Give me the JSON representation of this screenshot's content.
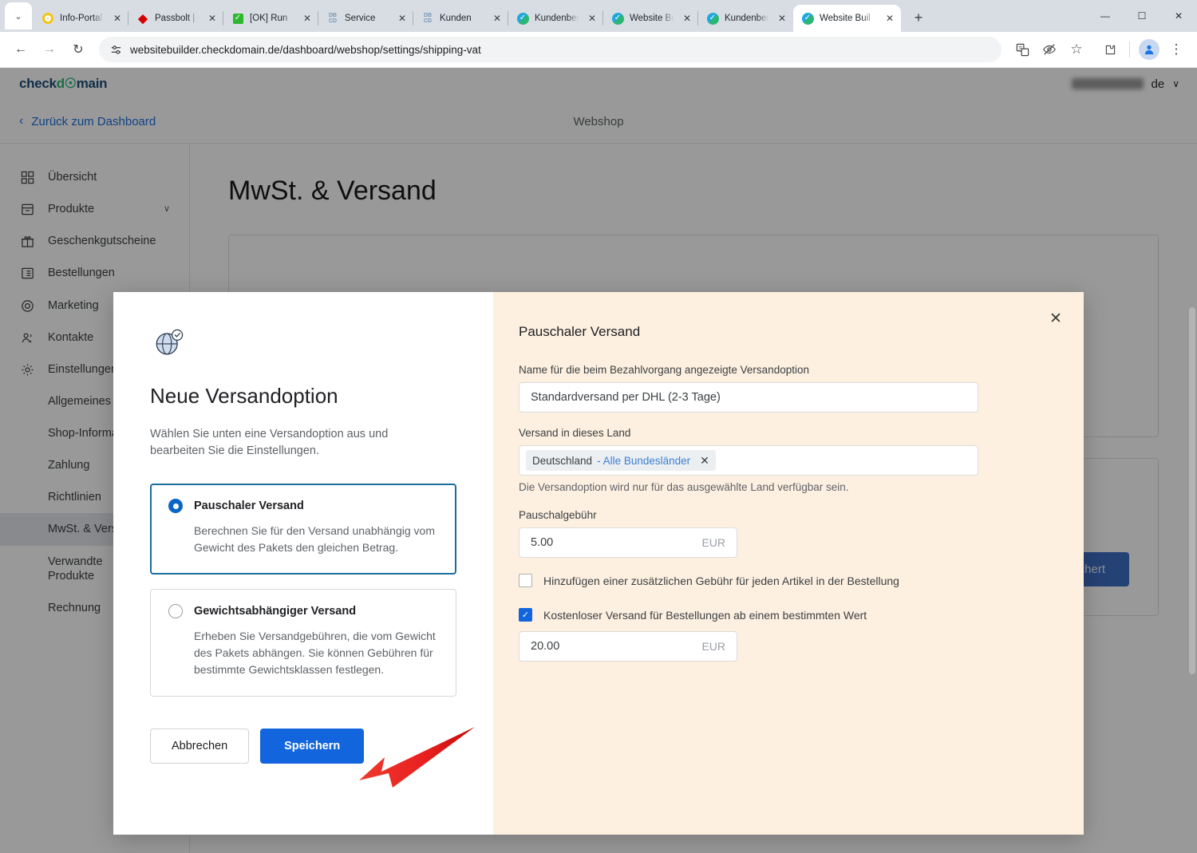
{
  "browser": {
    "tabs": [
      {
        "title": "Info-Portal D",
        "favicon": "circle-icon",
        "active": false
      },
      {
        "title": "Passbolt | Op",
        "favicon": "passbolt-icon",
        "active": false
      },
      {
        "title": "[OK] Run",
        "favicon": "green-check-icon",
        "active": false
      },
      {
        "title": "Service",
        "favicon": "dbcd-icon",
        "active": false
      },
      {
        "title": "Kunden",
        "favicon": "dbcd-icon",
        "active": false
      },
      {
        "title": "Kundenbere",
        "favicon": "checkdomain-icon",
        "active": false
      },
      {
        "title": "Website Buil",
        "favicon": "checkdomain-icon",
        "active": false
      },
      {
        "title": "Kundenbere",
        "favicon": "checkdomain-icon",
        "active": false
      },
      {
        "title": "Website Buil",
        "favicon": "checkdomain-icon",
        "active": true
      }
    ],
    "new_tab_label": "+",
    "tab_list_chevron": "⌄",
    "window_controls": {
      "minimize": "—",
      "maximize": "☐",
      "close": "✕"
    },
    "toolbar": {
      "back": "←",
      "forward": "→",
      "reload": "↻",
      "url": "websitebuilder.checkdomain.de/dashboard/webshop/settings/shipping-vat",
      "site_settings_icon": "tune-icon",
      "translate_icon": "translate-icon",
      "incognito_tracking_icon": "eye-off-icon",
      "bookmark_icon": "☆",
      "extensions_icon": "puzzle-icon",
      "profile_icon": "●",
      "menu_icon": "⋮"
    }
  },
  "app": {
    "logo": {
      "pre": "check",
      "accent": "d☉",
      "post": "main",
      "full": "checkdomain"
    },
    "language": "de",
    "language_chevron": "∨",
    "back_link": "Zurück zum Dashboard",
    "back_chevron": "‹",
    "section_title": "Webshop",
    "page_title": "MwSt. & Versand",
    "saved_button": "Gespeichert",
    "saved_button_right": "Gespeichert"
  },
  "sidebar": {
    "items": [
      {
        "label": "Übersicht",
        "icon": "grid-icon",
        "expandable": false
      },
      {
        "label": "Produkte",
        "icon": "box-icon",
        "expandable": true,
        "chevron": "∨"
      },
      {
        "label": "Geschenkgutscheine",
        "icon": "gift-icon",
        "expandable": false
      },
      {
        "label": "Bestellungen",
        "icon": "list-icon",
        "expandable": false
      },
      {
        "label": "Marketing",
        "icon": "target-icon",
        "expandable": false
      },
      {
        "label": "Kontakte",
        "icon": "people-icon",
        "expandable": false
      },
      {
        "label": "Einstellungen",
        "icon": "gear-icon",
        "expandable": false
      }
    ],
    "subitems": [
      {
        "label": "Allgemeines",
        "active": false
      },
      {
        "label": "Shop-Informationen",
        "active": false
      },
      {
        "label": "Zahlung",
        "active": false
      },
      {
        "label": "Richtlinien",
        "active": false
      },
      {
        "label": "MwSt. & Versand",
        "active": true
      },
      {
        "label": "Verwandte Produkte",
        "active": false
      },
      {
        "label": "Rechnung",
        "active": false
      }
    ]
  },
  "modal": {
    "icon": "globe-check-icon",
    "title": "Neue Versandoption",
    "subtitle": "Wählen Sie unten eine Versandoption aus und bearbeiten Sie die Einstellungen.",
    "options": [
      {
        "title": "Pauschaler Versand",
        "description": "Berechnen Sie für den Versand unabhängig vom Gewicht des Pakets den gleichen Betrag.",
        "selected": true
      },
      {
        "title": "Gewichtsabhängiger Versand",
        "description": "Erheben Sie Versandgebühren, die vom Gewicht des Pakets abhängen. Sie können Gebühren für bestimmte Gewichtsklassen festlegen.",
        "selected": false
      }
    ],
    "cancel_label": "Abbrechen",
    "save_label": "Speichern",
    "close_icon": "✕",
    "panel": {
      "title": "Pauschaler Versand",
      "name_label": "Name für die beim Bezahlvorgang angezeigte Versandoption",
      "name_value": "Standardversand per DHL (2-3 Tage)",
      "country_label": "Versand in dieses Land",
      "country_tag": "Deutschland",
      "country_tag_state": "- Alle Bundesländer",
      "country_tag_remove": "✕",
      "country_hint": "Die Versandoption wird nur für das ausgewählte Land verfügbar sein.",
      "fee_label": "Pauschalgebühr",
      "fee_value": "5.00",
      "fee_currency": "EUR",
      "extra_fee_checkbox_label": "Hinzufügen einer zusätzlichen Gebühr für jeden Artikel in der Bestellung",
      "extra_fee_checked": false,
      "free_shipping_checkbox_label": "Kostenloser Versand für Bestellungen ab einem bestimmten Wert",
      "free_shipping_checked": true,
      "free_shipping_value": "20.00",
      "free_shipping_currency": "EUR",
      "checkmark": "✓"
    }
  },
  "annotation": {
    "type": "red-arrow",
    "points_to": "Speichern"
  },
  "colors": {
    "accent_blue": "#1265dd",
    "panel_bg": "#fdf0e0",
    "selected_border": "#1a6e9e",
    "arrow_red": "#e8201f",
    "saved_button_bg": "#3f6ec4"
  }
}
